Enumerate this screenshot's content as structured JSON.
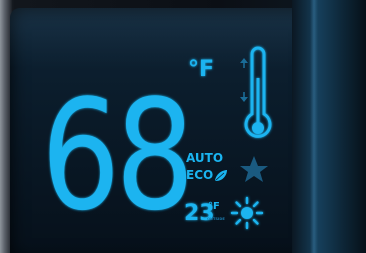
{
  "display": {
    "temperature": "68",
    "unit": "°F",
    "mode": "AUTO",
    "eco": "ECO",
    "outside_temperature": "23",
    "outside_unit": "°F",
    "outside_caption": "OUTSIDE"
  },
  "icons": {
    "up_arrow": "up-arrow-icon",
    "down_arrow": "down-arrow-icon",
    "thermometer": "thermometer-icon",
    "eco_leaf": "leaf-icon",
    "snowflake": "snowflake-icon",
    "sun": "sun-icon"
  },
  "colors": {
    "accent": "#1ab4f0",
    "accent_dim": "#1a6c97",
    "screen": "#0a1a28"
  }
}
